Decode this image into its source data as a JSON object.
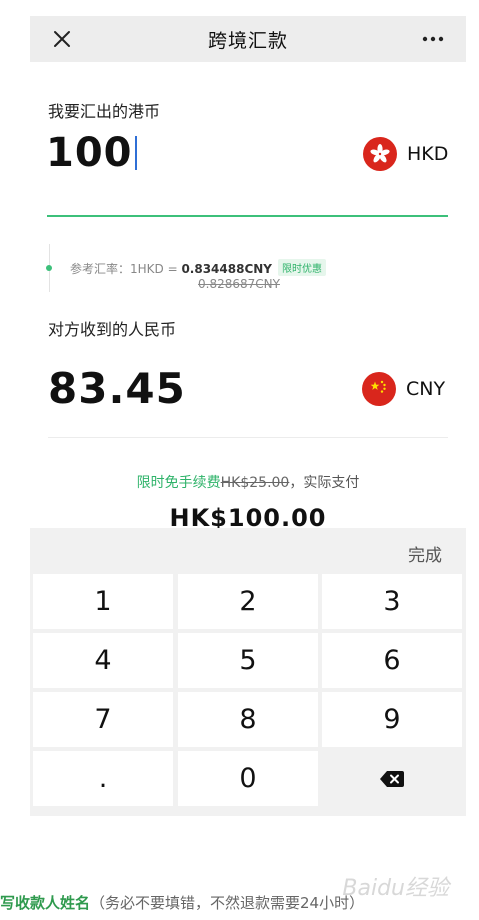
{
  "header": {
    "title": "跨境汇款",
    "close_icon": "close-icon",
    "more_icon": "more-dots-icon"
  },
  "send": {
    "label": "我要汇出的港币",
    "amount": "100",
    "currency_code": "HKD",
    "flag_icon": "hong-kong-flag-icon"
  },
  "rate": {
    "prefix": "参考汇率：1HKD = ",
    "value": "0.834488CNY",
    "badge": "限时优惠",
    "old_value": "0.828687CNY"
  },
  "receive": {
    "label": "对方收到的人民币",
    "amount": "83.45",
    "currency_code": "CNY",
    "flag_icon": "china-flag-icon"
  },
  "fee": {
    "free_text": "限时免手续费",
    "old_fee": "HK$25.00",
    "suffix": "，实际支付",
    "total": "HK$100.00"
  },
  "keyboard": {
    "done_label": "完成",
    "keys": [
      "1",
      "2",
      "3",
      "4",
      "5",
      "6",
      "7",
      "8",
      "9",
      ".",
      "0"
    ],
    "backspace_icon": "backspace-icon"
  },
  "footer": {
    "green_text": "写收款人姓名",
    "gray_text": "（务必不要填错，不然退款需要24小时）",
    "watermark": "Baidu经验"
  },
  "colors": {
    "accent_green": "#3cc07a",
    "flag_red": "#d9261c",
    "header_gray": "#ededed",
    "keyboard_gray": "#f1f1f1"
  }
}
